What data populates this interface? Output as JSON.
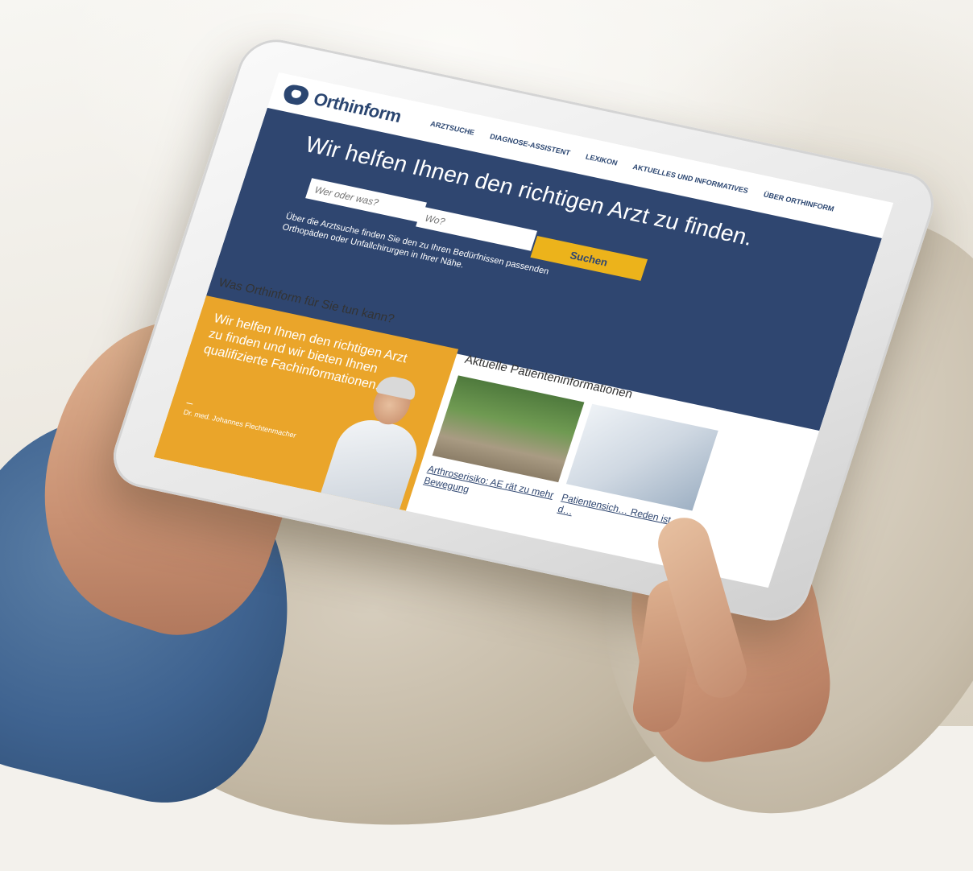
{
  "site": {
    "logo_text": "Orthinform",
    "nav": [
      "ARZTSUCHE",
      "DIAGNOSE-ASSISTENT",
      "LEXIKON",
      "AKTUELLES UND INFORMATIVES",
      "ÜBER ORTHINFORM"
    ]
  },
  "hero": {
    "title": "Wir helfen Ihnen den richtigen Arzt zu finden.",
    "who_placeholder": "Wer oder was?",
    "where_placeholder": "Wo?",
    "search_button": "Suchen",
    "description": "Über die Arztsuche finden Sie den zu Ihren Bedürfnissen passenden Orthopäden oder Unfallchirurgen in Ihrer Nähe."
  },
  "about": {
    "title": "Was Orthinform für Sie tun kann?",
    "promo_text": "Wir helfen Ihnen den richtigen Arzt zu finden und wir bieten Ihnen qualifizierte Fachinformationen.",
    "dash": "–",
    "author": "Dr. med. Johannes Flechtenmacher"
  },
  "news": {
    "title": "Aktuelle Patienteninformationen",
    "cards": [
      {
        "caption": "Arthroserisiko: AE rät zu mehr Bewegung"
      },
      {
        "caption": "Patientensich… Reden ist d…"
      }
    ]
  },
  "colors": {
    "navy": "#2f4670",
    "accent_yellow": "#ecb31b",
    "promo_orange": "#eaa52a"
  }
}
